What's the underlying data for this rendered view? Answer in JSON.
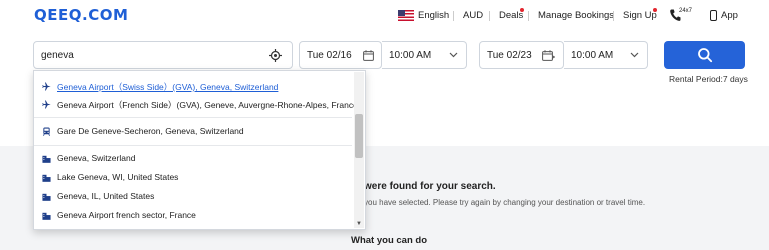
{
  "header": {
    "logo": "QEEQ.COM",
    "language": "English",
    "currency": "AUD",
    "deals": "Deals",
    "manage_bookings": "Manage Bookings",
    "sign_up": "Sign Up",
    "support_hours": "24x7",
    "app": "App"
  },
  "search": {
    "location_value": "geneva",
    "pickup_date": "Tue 02/16",
    "pickup_time": "10:00 AM",
    "dropoff_date": "Tue 02/23",
    "dropoff_time": "10:00 AM",
    "rental_period": "Rental Period:7 days"
  },
  "suggestions": [
    {
      "type": "airport",
      "icon": "plane-icon",
      "label": "Geneva Airport（Swiss Side）(GVA), Geneva, Switzerland",
      "active": true
    },
    {
      "type": "airport",
      "icon": "plane-icon",
      "label": "Geneva Airport（French Side）(GVA), Geneve, Auvergne-Rhone-Alpes, France"
    },
    {
      "type": "station",
      "icon": "train-icon",
      "label": "Gare De Geneve-Secheron, Geneva, Switzerland"
    },
    {
      "type": "city",
      "icon": "city-icon",
      "label": "Geneva, Switzerland"
    },
    {
      "type": "city",
      "icon": "city-icon",
      "label": "Lake Geneva, WI, United States"
    },
    {
      "type": "city",
      "icon": "city-icon",
      "label": "Geneva, IL, United States"
    },
    {
      "type": "city",
      "icon": "city-icon",
      "label": "Geneva Airport french sector, France"
    }
  ],
  "results_message": {
    "title": "were found for your search.",
    "body": "you have selected. Please try again by changing your destination or travel time.",
    "what_you_can_do": "What you can do"
  },
  "colors": {
    "brand": "#1f5fd6",
    "button": "#2563d8",
    "notification": "#e3262f"
  }
}
